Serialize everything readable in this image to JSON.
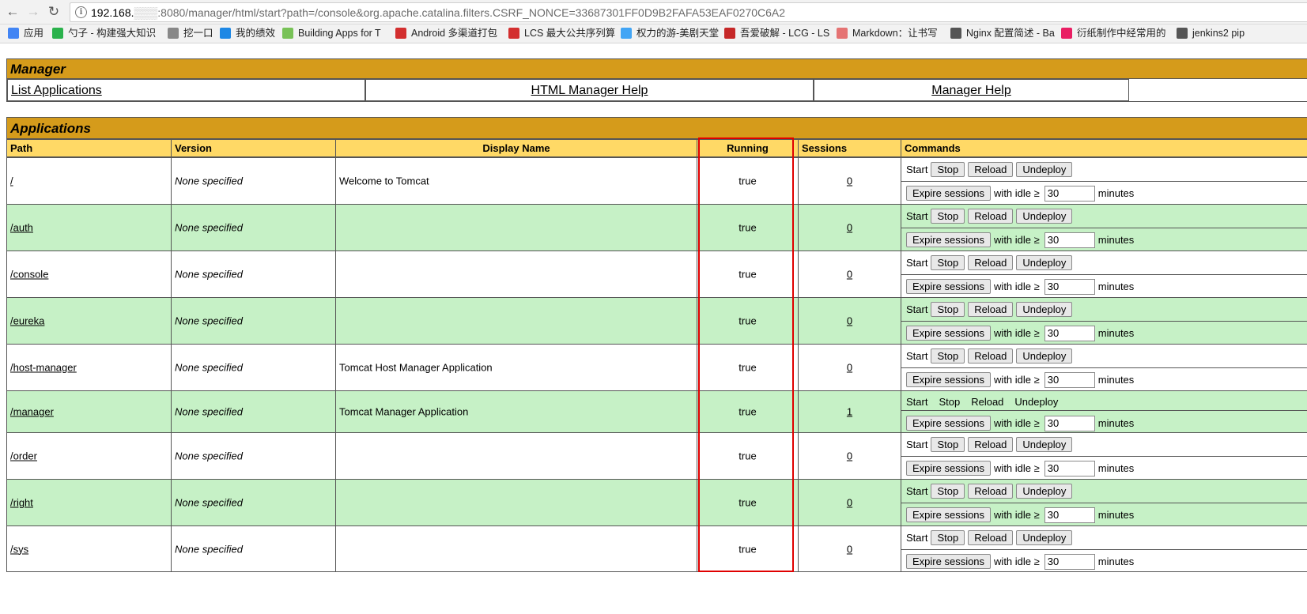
{
  "browser": {
    "url_host": "192.168.",
    "url_rest": ":8080/manager/html/start?path=/console&org.apache.catalina.filters.CSRF_NONCE=33687301FF0D9B2FAFA53EAF0270C6A2",
    "bookmarks": [
      {
        "label": "应用",
        "color": "#4285f4"
      },
      {
        "label": "勺子 - 构建强大知识",
        "color": "#2bb24c"
      },
      {
        "label": "挖一口",
        "color": "#888888"
      },
      {
        "label": "我的绩效",
        "color": "#1e88e5"
      },
      {
        "label": "Building Apps for T",
        "color": "#78c257"
      },
      {
        "label": "Android 多渠道打包",
        "color": "#d32f2f"
      },
      {
        "label": "LCS 最大公共序列算",
        "color": "#d32f2f"
      },
      {
        "label": "权力的游-美剧天堂",
        "color": "#42a5f5"
      },
      {
        "label": "吾爱破解 - LCG - LS",
        "color": "#c62828"
      },
      {
        "label": "Markdown：让书写",
        "color": "#e57373"
      },
      {
        "label": "Nginx 配置简述 - Ba",
        "color": "#555555"
      },
      {
        "label": "衍纸制作中经常用的",
        "color": "#e91e63"
      },
      {
        "label": "jenkins2 pip",
        "color": "#555555"
      }
    ]
  },
  "manager": {
    "title": "Manager",
    "links": [
      "List Applications",
      "HTML Manager Help",
      "Manager Help"
    ]
  },
  "applications": {
    "title": "Applications",
    "columns": [
      "Path",
      "Version",
      "Display Name",
      "Running",
      "Sessions",
      "Commands"
    ],
    "commands": {
      "start": "Start",
      "stop": "Stop",
      "reload": "Reload",
      "undeploy": "Undeploy",
      "expire": "Expire sessions",
      "with_idle": "with idle ≥",
      "minutes": "minutes"
    },
    "rows": [
      {
        "path": "/",
        "version": "None specified",
        "display_name": "Welcome to Tomcat",
        "running": "true",
        "sessions": "0",
        "idle": "30"
      },
      {
        "path": "/auth",
        "version": "None specified",
        "display_name": "",
        "running": "true",
        "sessions": "0",
        "idle": "30"
      },
      {
        "path": "/console",
        "version": "None specified",
        "display_name": "",
        "running": "true",
        "sessions": "0",
        "idle": "30"
      },
      {
        "path": "/eureka",
        "version": "None specified",
        "display_name": "",
        "running": "true",
        "sessions": "0",
        "idle": "30"
      },
      {
        "path": "/host-manager",
        "version": "None specified",
        "display_name": "Tomcat Host Manager Application",
        "running": "true",
        "sessions": "0",
        "idle": "30"
      },
      {
        "path": "/manager",
        "version": "None specified",
        "display_name": "Tomcat Manager Application",
        "running": "true",
        "sessions": "1",
        "idle": "30"
      },
      {
        "path": "/order",
        "version": "None specified",
        "display_name": "",
        "running": "true",
        "sessions": "0",
        "idle": "30"
      },
      {
        "path": "/right",
        "version": "None specified",
        "display_name": "",
        "running": "true",
        "sessions": "0",
        "idle": "30"
      },
      {
        "path": "/sys",
        "version": "None specified",
        "display_name": "",
        "running": "true",
        "sessions": "0",
        "idle": "30"
      }
    ]
  },
  "colors": {
    "header_gold": "#d59b1b",
    "column_header": "#ffd966",
    "row_green": "#c6f1c6",
    "highlight_red": "#e00000"
  }
}
